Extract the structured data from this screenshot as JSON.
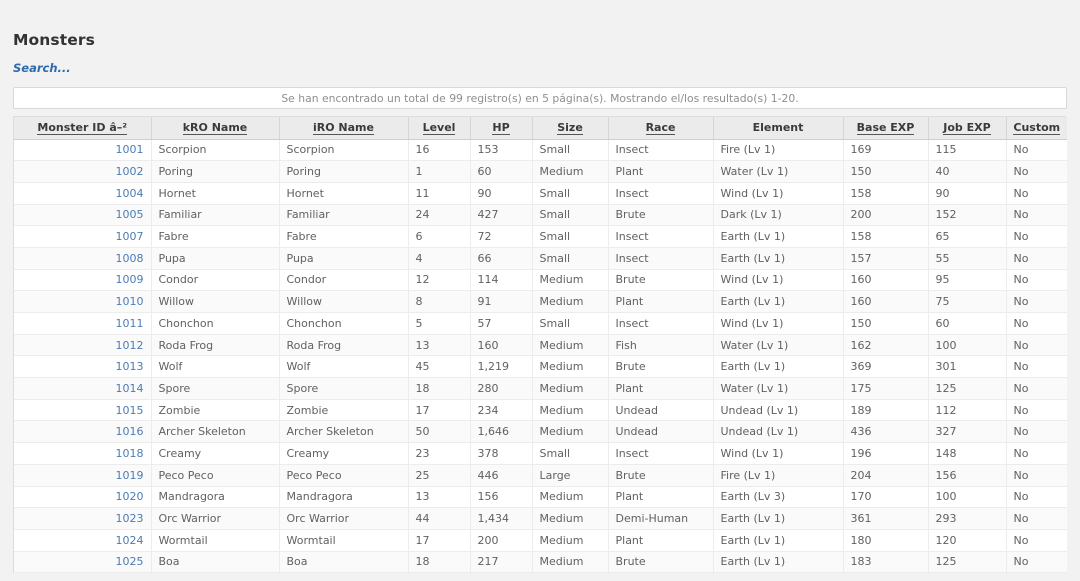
{
  "page": {
    "title": "Monsters",
    "search_link": "Search...",
    "info": "Se han encontrado un total de 99 registro(s) en 5 página(s). Mostrando el/los resultado(s) 1-20.",
    "accent_link_color": "#2e6ab1",
    "id_link_color": "#4a7cb5",
    "header_bg": "#ebebeb",
    "page_bg": "#f2f2f2"
  },
  "results": {
    "total_records": 99,
    "total_pages": 5,
    "showing_from": 1,
    "showing_to": 20
  },
  "table": {
    "columns": [
      {
        "label": "Monster ID â–²",
        "sortable": true,
        "align": "right"
      },
      {
        "label": "kRO Name",
        "sortable": true,
        "align": "left"
      },
      {
        "label": "iRO Name",
        "sortable": true,
        "align": "left"
      },
      {
        "label": "Level",
        "sortable": true,
        "align": "left"
      },
      {
        "label": "HP",
        "sortable": true,
        "align": "left"
      },
      {
        "label": "Size",
        "sortable": true,
        "align": "left"
      },
      {
        "label": "Race",
        "sortable": true,
        "align": "left"
      },
      {
        "label": "Element",
        "sortable": false,
        "align": "left"
      },
      {
        "label": "Base EXP",
        "sortable": true,
        "align": "left"
      },
      {
        "label": "Job EXP",
        "sortable": true,
        "align": "left"
      },
      {
        "label": "Custom",
        "sortable": true,
        "align": "left"
      }
    ],
    "rows": [
      {
        "id": "1001",
        "kro": "Scorpion",
        "iro": "Scorpion",
        "level": "16",
        "hp": "153",
        "size": "Small",
        "race": "Insect",
        "element": "Fire (Lv 1)",
        "base_exp": "169",
        "job_exp": "115",
        "custom": "No"
      },
      {
        "id": "1002",
        "kro": "Poring",
        "iro": "Poring",
        "level": "1",
        "hp": "60",
        "size": "Medium",
        "race": "Plant",
        "element": "Water (Lv 1)",
        "base_exp": "150",
        "job_exp": "40",
        "custom": "No"
      },
      {
        "id": "1004",
        "kro": "Hornet",
        "iro": "Hornet",
        "level": "11",
        "hp": "90",
        "size": "Small",
        "race": "Insect",
        "element": "Wind (Lv 1)",
        "base_exp": "158",
        "job_exp": "90",
        "custom": "No"
      },
      {
        "id": "1005",
        "kro": "Familiar",
        "iro": "Familiar",
        "level": "24",
        "hp": "427",
        "size": "Small",
        "race": "Brute",
        "element": "Dark (Lv 1)",
        "base_exp": "200",
        "job_exp": "152",
        "custom": "No"
      },
      {
        "id": "1007",
        "kro": "Fabre",
        "iro": "Fabre",
        "level": "6",
        "hp": "72",
        "size": "Small",
        "race": "Insect",
        "element": "Earth (Lv 1)",
        "base_exp": "158",
        "job_exp": "65",
        "custom": "No"
      },
      {
        "id": "1008",
        "kro": "Pupa",
        "iro": "Pupa",
        "level": "4",
        "hp": "66",
        "size": "Small",
        "race": "Insect",
        "element": "Earth (Lv 1)",
        "base_exp": "157",
        "job_exp": "55",
        "custom": "No"
      },
      {
        "id": "1009",
        "kro": "Condor",
        "iro": "Condor",
        "level": "12",
        "hp": "114",
        "size": "Medium",
        "race": "Brute",
        "element": "Wind (Lv 1)",
        "base_exp": "160",
        "job_exp": "95",
        "custom": "No"
      },
      {
        "id": "1010",
        "kro": "Willow",
        "iro": "Willow",
        "level": "8",
        "hp": "91",
        "size": "Medium",
        "race": "Plant",
        "element": "Earth (Lv 1)",
        "base_exp": "160",
        "job_exp": "75",
        "custom": "No"
      },
      {
        "id": "1011",
        "kro": "Chonchon",
        "iro": "Chonchon",
        "level": "5",
        "hp": "57",
        "size": "Small",
        "race": "Insect",
        "element": "Wind (Lv 1)",
        "base_exp": "150",
        "job_exp": "60",
        "custom": "No"
      },
      {
        "id": "1012",
        "kro": "Roda Frog",
        "iro": "Roda Frog",
        "level": "13",
        "hp": "160",
        "size": "Medium",
        "race": "Fish",
        "element": "Water (Lv 1)",
        "base_exp": "162",
        "job_exp": "100",
        "custom": "No"
      },
      {
        "id": "1013",
        "kro": "Wolf",
        "iro": "Wolf",
        "level": "45",
        "hp": "1,219",
        "size": "Medium",
        "race": "Brute",
        "element": "Earth (Lv 1)",
        "base_exp": "369",
        "job_exp": "301",
        "custom": "No"
      },
      {
        "id": "1014",
        "kro": "Spore",
        "iro": "Spore",
        "level": "18",
        "hp": "280",
        "size": "Medium",
        "race": "Plant",
        "element": "Water (Lv 1)",
        "base_exp": "175",
        "job_exp": "125",
        "custom": "No"
      },
      {
        "id": "1015",
        "kro": "Zombie",
        "iro": "Zombie",
        "level": "17",
        "hp": "234",
        "size": "Medium",
        "race": "Undead",
        "element": "Undead (Lv 1)",
        "base_exp": "189",
        "job_exp": "112",
        "custom": "No"
      },
      {
        "id": "1016",
        "kro": "Archer Skeleton",
        "iro": "Archer Skeleton",
        "level": "50",
        "hp": "1,646",
        "size": "Medium",
        "race": "Undead",
        "element": "Undead (Lv 1)",
        "base_exp": "436",
        "job_exp": "327",
        "custom": "No"
      },
      {
        "id": "1018",
        "kro": "Creamy",
        "iro": "Creamy",
        "level": "23",
        "hp": "378",
        "size": "Small",
        "race": "Insect",
        "element": "Wind (Lv 1)",
        "base_exp": "196",
        "job_exp": "148",
        "custom": "No"
      },
      {
        "id": "1019",
        "kro": "Peco Peco",
        "iro": "Peco Peco",
        "level": "25",
        "hp": "446",
        "size": "Large",
        "race": "Brute",
        "element": "Fire (Lv 1)",
        "base_exp": "204",
        "job_exp": "156",
        "custom": "No"
      },
      {
        "id": "1020",
        "kro": "Mandragora",
        "iro": "Mandragora",
        "level": "13",
        "hp": "156",
        "size": "Medium",
        "race": "Plant",
        "element": "Earth (Lv 3)",
        "base_exp": "170",
        "job_exp": "100",
        "custom": "No"
      },
      {
        "id": "1023",
        "kro": "Orc Warrior",
        "iro": "Orc Warrior",
        "level": "44",
        "hp": "1,434",
        "size": "Medium",
        "race": "Demi-Human",
        "element": "Earth (Lv 1)",
        "base_exp": "361",
        "job_exp": "293",
        "custom": "No"
      },
      {
        "id": "1024",
        "kro": "Wormtail",
        "iro": "Wormtail",
        "level": "17",
        "hp": "200",
        "size": "Medium",
        "race": "Plant",
        "element": "Earth (Lv 1)",
        "base_exp": "180",
        "job_exp": "120",
        "custom": "No"
      },
      {
        "id": "1025",
        "kro": "Boa",
        "iro": "Boa",
        "level": "18",
        "hp": "217",
        "size": "Medium",
        "race": "Brute",
        "element": "Earth (Lv 1)",
        "base_exp": "183",
        "job_exp": "125",
        "custom": "No"
      }
    ]
  }
}
